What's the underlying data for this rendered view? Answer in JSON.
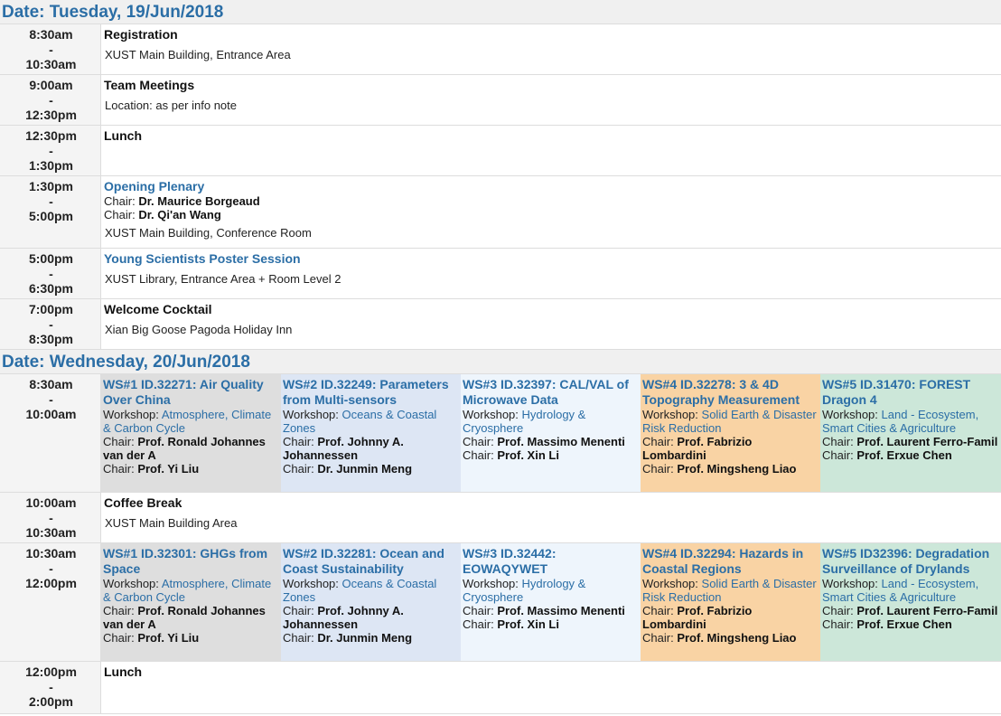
{
  "days": [
    {
      "date_label": "Date: Tuesday, 19/Jun/2018",
      "sessions": [
        {
          "start": "8:30am",
          "sep": "-",
          "end": "10:30am",
          "title": "Registration",
          "location": "XUST Main Building, Entrance Area"
        },
        {
          "start": "9:00am",
          "sep": "-",
          "end": "12:30pm",
          "title": "Team Meetings",
          "location": "Location: as per info note"
        },
        {
          "start": "12:30pm",
          "sep": "-",
          "end": "1:30pm",
          "title": "Lunch"
        },
        {
          "start": "1:30pm",
          "sep": "-",
          "end": "5:00pm",
          "title": "Opening Plenary",
          "chair_prefix": "Chair:",
          "chair1": "Dr. Maurice Borgeaud",
          "chair2": "Dr. Qi'an Wang",
          "location": "XUST Main Building, Conference Room"
        },
        {
          "start": "5:00pm",
          "sep": "-",
          "end": "6:30pm",
          "title": "Young Scientists Poster Session",
          "location": "XUST Library, Entrance Area + Room Level 2"
        },
        {
          "start": "7:00pm",
          "sep": "-",
          "end": "8:30pm",
          "title": "Welcome Cocktail",
          "location": "Xian Big Goose Pagoda Holiday Inn"
        }
      ]
    },
    {
      "date_label": "Date: Wednesday, 20/Jun/2018",
      "sessions": [
        {
          "start": "8:30am",
          "sep": "-",
          "end": "10:00am",
          "workshops": [
            {
              "title": "WS#1 ID.32271: Air Quality Over China",
              "workshop_prefix": "Workshop:",
              "workshop": "Atmosphere, Climate & Carbon Cycle",
              "chair_prefix": "Chair:",
              "chair1": "Prof. Ronald Johannes van der A",
              "chair2": "Prof. Yi Liu",
              "color": "#dedede"
            },
            {
              "title": "WS#2 ID.32249: Parameters from Multi-sensors",
              "workshop_prefix": "Workshop:",
              "workshop": "Oceans & Coastal Zones",
              "chair_prefix": "Chair:",
              "chair1": "Prof. Johnny A. Johannessen",
              "chair2": "Dr. Junmin Meng",
              "color": "#dde6f4"
            },
            {
              "title": "WS#3 ID.32397: CAL/VAL of Microwave Data",
              "workshop_prefix": "Workshop:",
              "workshop": "Hydrology & Cryosphere",
              "chair_prefix": "Chair:",
              "chair1": "Prof. Massimo Menenti",
              "chair2": "Prof. Xin Li",
              "color": "#eef5fc"
            },
            {
              "title": "WS#4 ID.32278: 3 & 4D Topography Measurement",
              "workshop_prefix": "Workshop:",
              "workshop": "Solid Earth & Disaster Risk Reduction",
              "chair_prefix": "Chair:",
              "chair1": "Prof. Fabrizio Lombardini",
              "chair2": "Prof. Mingsheng Liao",
              "color": "#f9d3a4"
            },
            {
              "title": "WS#5 ID.31470: FOREST Dragon 4",
              "workshop_prefix": "Workshop:",
              "workshop": "Land - Ecosystem, Smart Cities & Agriculture",
              "chair_prefix": "Chair:",
              "chair1": "Prof. Laurent Ferro-Famil",
              "chair2": "Prof. Erxue Chen",
              "color": "#cce7d9"
            }
          ]
        },
        {
          "start": "10:00am",
          "sep": "-",
          "end": "10:30am",
          "title": "Coffee Break",
          "location": "XUST Main Building Area"
        },
        {
          "start": "10:30am",
          "sep": "-",
          "end": "12:00pm",
          "workshops": [
            {
              "title": "WS#1 ID.32301: GHGs from Space",
              "workshop_prefix": "Workshop:",
              "workshop": "Atmosphere, Climate & Carbon Cycle",
              "chair_prefix": "Chair:",
              "chair1": "Prof. Ronald Johannes van der A",
              "chair2": "Prof. Yi Liu",
              "color": "#dedede"
            },
            {
              "title": "WS#2 ID.32281: Ocean and Coast Sustainability",
              "workshop_prefix": "Workshop:",
              "workshop": "Oceans & Coastal Zones",
              "chair_prefix": "Chair:",
              "chair1": "Prof. Johnny A. Johannessen",
              "chair2": "Dr. Junmin Meng",
              "color": "#dde6f4"
            },
            {
              "title": "WS#3 ID.32442: EOWAQYWET",
              "workshop_prefix": "Workshop:",
              "workshop": "Hydrology & Cryosphere",
              "chair_prefix": "Chair:",
              "chair1": "Prof. Massimo Menenti",
              "chair2": "Prof. Xin Li",
              "color": "#eef5fc"
            },
            {
              "title": "WS#4 ID.32294: Hazards in Coastal Regions",
              "workshop_prefix": "Workshop:",
              "workshop": "Solid Earth & Disaster Risk Reduction",
              "chair_prefix": "Chair:",
              "chair1": "Prof. Fabrizio Lombardini",
              "chair2": "Prof. Mingsheng Liao",
              "color": "#f9d3a4"
            },
            {
              "title": "WS#5 ID32396: Degradation Surveillance of Drylands",
              "workshop_prefix": "Workshop:",
              "workshop": "Land - Ecosystem, Smart Cities & Agriculture",
              "chair_prefix": "Chair:",
              "chair1": "Prof. Laurent Ferro-Famil",
              "chair2": "Prof. Erxue Chen",
              "color": "#cce7d9"
            }
          ]
        },
        {
          "start": "12:00pm",
          "sep": "-",
          "end": "2:00pm",
          "title": "Lunch"
        }
      ]
    }
  ]
}
